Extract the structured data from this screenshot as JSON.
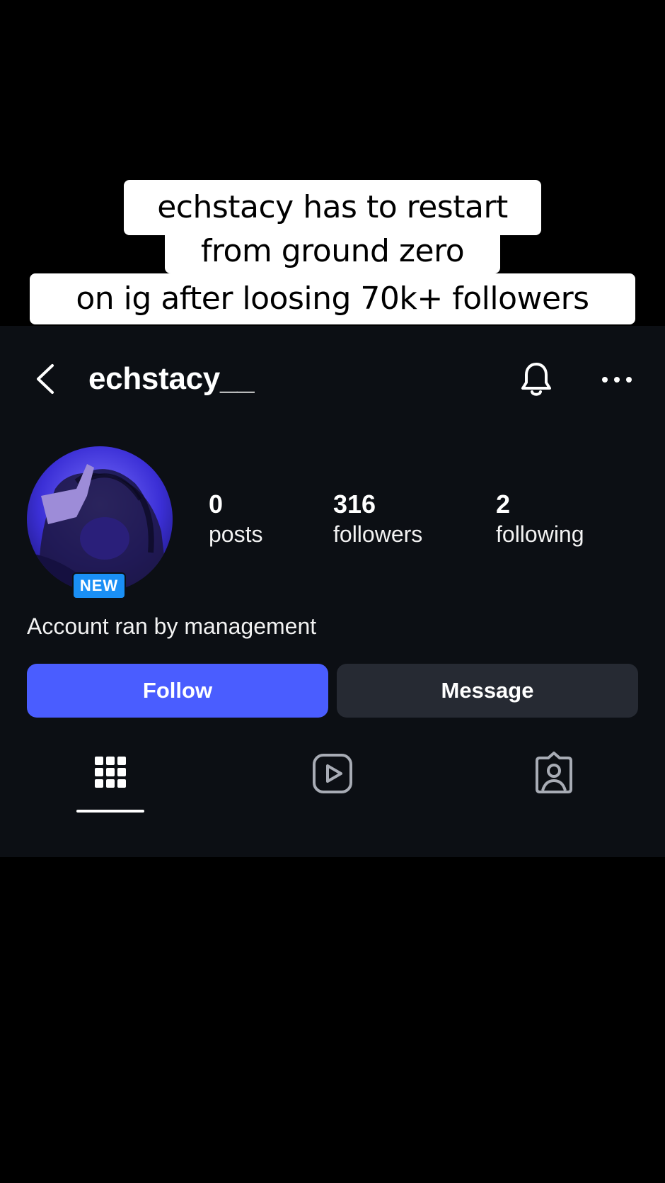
{
  "caption": {
    "line1": "echstacy has to restart",
    "line2": "from ground zero",
    "line3": "on ig after loosing 70k+ followers"
  },
  "header": {
    "username": "echstacy__",
    "icons": [
      "chevron-left-icon",
      "bell-icon",
      "more-horizontal-icon"
    ]
  },
  "profile": {
    "badge": "NEW",
    "stats": [
      {
        "value": "0",
        "label": "posts"
      },
      {
        "value": "316",
        "label": "followers"
      },
      {
        "value": "2",
        "label": "following"
      }
    ],
    "bio": "Account ran by management"
  },
  "actions": {
    "follow_label": "Follow",
    "message_label": "Message"
  },
  "tabs": [
    {
      "icon": "grid-icon",
      "active": true
    },
    {
      "icon": "reels-icon",
      "active": false
    },
    {
      "icon": "tagged-icon",
      "active": false
    }
  ],
  "colors": {
    "screen_bg": "#0c0f14",
    "follow_button": "#4a5dff",
    "message_button": "#262a33",
    "badge": "#1a8ff5"
  }
}
